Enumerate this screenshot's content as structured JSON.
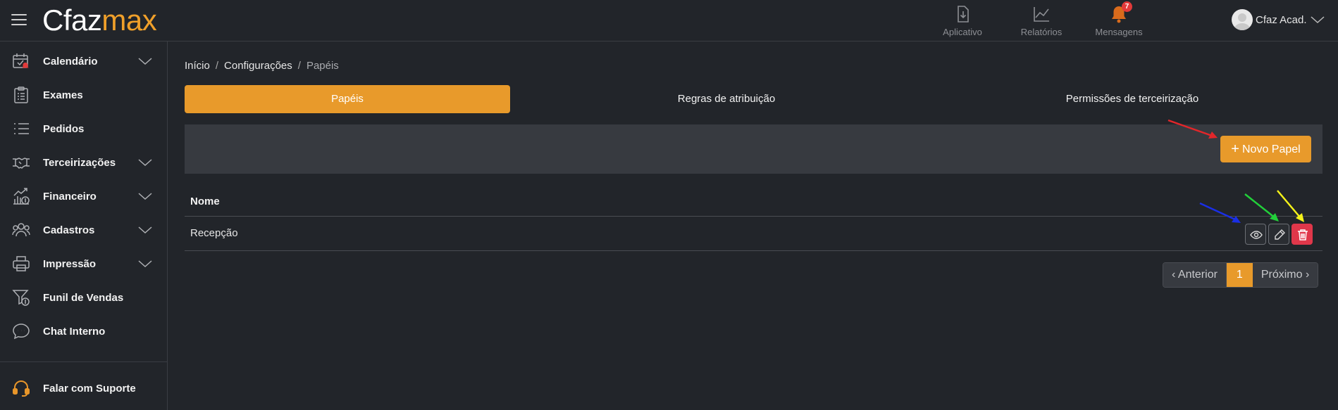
{
  "header": {
    "logo_part1": "Cfaz",
    "logo_part2": "max",
    "nav": [
      {
        "label": "Aplicativo",
        "icon": "download-document-icon"
      },
      {
        "label": "Relatórios",
        "icon": "chart-line-icon"
      },
      {
        "label": "Mensagens",
        "icon": "bell-icon",
        "badge": "7"
      }
    ],
    "user_name": "Cfaz Acad."
  },
  "sidebar": {
    "items": [
      {
        "label": "Calendário",
        "icon": "calendar-icon",
        "expandable": true
      },
      {
        "label": "Exames",
        "icon": "clipboard-icon",
        "expandable": false
      },
      {
        "label": "Pedidos",
        "icon": "list-icon",
        "expandable": false
      },
      {
        "label": "Terceirizações",
        "icon": "handshake-icon",
        "expandable": true
      },
      {
        "label": "Financeiro",
        "icon": "finance-chart-icon",
        "expandable": true
      },
      {
        "label": "Cadastros",
        "icon": "users-icon",
        "expandable": true
      },
      {
        "label": "Impressão",
        "icon": "printer-icon",
        "expandable": true
      },
      {
        "label": "Funil de Vendas",
        "icon": "funnel-icon",
        "expandable": false
      },
      {
        "label": "Chat Interno",
        "icon": "chat-icon",
        "expandable": false
      }
    ],
    "support_label": "Falar com Suporte"
  },
  "breadcrumb": {
    "items": [
      "Início",
      "Configurações",
      "Papéis"
    ]
  },
  "tabs": [
    {
      "label": "Papéis",
      "active": true
    },
    {
      "label": "Regras de atribuição",
      "active": false
    },
    {
      "label": "Permissões de terceirização",
      "active": false
    }
  ],
  "toolbar": {
    "new_button_label": "Novo Papel"
  },
  "table": {
    "columns": [
      "Nome"
    ],
    "rows": [
      {
        "name": "Recepção"
      }
    ]
  },
  "pagination": {
    "prev_label": "‹ Anterior",
    "current": "1",
    "next_label": "Próximo ›"
  },
  "colors": {
    "accent": "#e89a2b",
    "danger": "#e0374a",
    "background": "#22252a",
    "arrow_red": "#e3262a",
    "arrow_green": "#22d03a",
    "arrow_yellow": "#f4f21a",
    "arrow_blue": "#1a2fe6"
  }
}
